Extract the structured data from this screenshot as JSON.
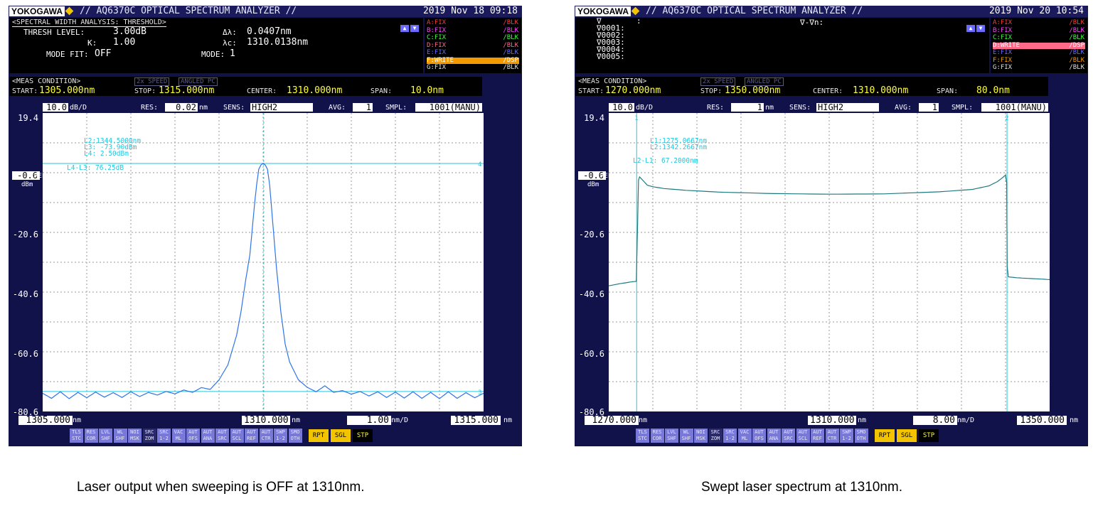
{
  "captions": {
    "left": "Laser output when sweeping is OFF at 1310nm.",
    "right": "Swept laser spectrum at 1310nm."
  },
  "colors": {
    "screen_bg": "#12124a",
    "panel_bg": "#000000",
    "value_yellow": "#ffff33",
    "trace_blue": "#2e74e8",
    "trace_teal": "#1e7a80",
    "marker_cyan": "#22c6dd",
    "orange_highlight": "#f29a00",
    "pink_highlight": "#ff6a8a"
  },
  "left": {
    "header": {
      "brand": "YOKOGAWA",
      "model": "// AQ6370C OPTICAL SPECTRUM ANALYZER //",
      "datetime": "2019 Nov 18 09:18"
    },
    "analysis": {
      "title": "<SPECTRAL WIDTH ANALYSIS: THRESHOLD>",
      "thresh_label": "THRESH LEVEL:",
      "thresh_value": "3.00dB",
      "k_label": "K:",
      "k_value": "1.00",
      "mode_fit_label": "MODE FIT:",
      "mode_fit_value": "OFF",
      "dl_label": "Δλ:",
      "dl_value": "0.0407nm",
      "lc_label": "λc:",
      "lc_value": "1310.0138nm",
      "mode_label": "MODE:",
      "mode_value": "1"
    },
    "traces": [
      {
        "label": "A:FIX",
        "mode": "/BLK",
        "color": "#ff3a3a"
      },
      {
        "label": "B:FIX",
        "mode": "/BLK",
        "color": "#ff40ff"
      },
      {
        "label": "C:FIX",
        "mode": "/BLK",
        "color": "#40ff40"
      },
      {
        "label": "D:FIX",
        "mode": "/BLK",
        "color": "#ff6a8a"
      },
      {
        "label": "E:FIX",
        "mode": "/BLK",
        "color": "#6a6aff"
      },
      {
        "label": "F:WRITE",
        "mode": "/DSP",
        "color": "#f29a00",
        "highlight": true
      },
      {
        "label": "G:FIX",
        "mode": "/BLK",
        "color": "#e0e0e0"
      }
    ],
    "meas": {
      "title": "<MEAS CONDITION>",
      "tags": [
        "2x SPEED",
        "ANGLED PC"
      ],
      "start_label": "START:",
      "start_value": "1305.000nm",
      "stop_label": "STOP:",
      "stop_value": "1315.000nm",
      "center_label": "CENTER:",
      "center_value": "1310.000nm",
      "span_label": "SPAN:",
      "span_value": "10.0nm"
    },
    "params": {
      "scale": "10.0",
      "scale_unit": "dB/D",
      "res_label": "RES:",
      "res_value": "0.02",
      "res_unit": "nm",
      "sens_label": "SENS:",
      "sens_value": "HIGH2",
      "avg_label": "AVG:",
      "avg_value": "1",
      "smpl_label": "SMPL:",
      "smpl_value": "1001(MANU)"
    },
    "ref": {
      "value": "-0.6",
      "label": "REF",
      "unit": "dBm"
    },
    "x_footer": {
      "left": "1305.000",
      "center": "1310.000",
      "per_div": "1.00",
      "right": "1315.000",
      "unit": "nm",
      "per_div_unit": "nm/D"
    },
    "marker_info": [
      "L2:1344.5000nm",
      "L3:  -73.90dBm",
      "L4:    2.50dBm",
      "L4-L3:  76.25dB"
    ],
    "marker_tags": [
      "4",
      "3"
    ]
  },
  "right": {
    "header": {
      "brand": "YOKOGAWA",
      "model": "// AQ6370C OPTICAL SPECTRUM ANALYZER //",
      "datetime": "2019 Nov 20 10:54"
    },
    "markers_panel": {
      "rows": [
        {
          "name": "∇",
          "value": ":"
        },
        {
          "name": "∇0001:",
          "value": ""
        },
        {
          "name": "∇0002:",
          "value": ""
        },
        {
          "name": "∇0003:",
          "value": ""
        },
        {
          "name": "∇0004:",
          "value": ""
        },
        {
          "name": "∇0005:",
          "value": ""
        }
      ],
      "diff_label": "∇-∇n:"
    },
    "traces": [
      {
        "label": "A:FIX",
        "mode": "/BLK",
        "color": "#ff3a3a"
      },
      {
        "label": "B:FIX",
        "mode": "/BLK",
        "color": "#ff40ff"
      },
      {
        "label": "C:FIX",
        "mode": "/BLK",
        "color": "#40ff40"
      },
      {
        "label": "D:WRITE",
        "mode": "/DSP",
        "color": "#ff6a8a",
        "highlight": true
      },
      {
        "label": "E:FIX",
        "mode": "/BLK",
        "color": "#6a6aff"
      },
      {
        "label": "F:FIX",
        "mode": "/BLK",
        "color": "#f29a00"
      },
      {
        "label": "G:FIX",
        "mode": "/BLK",
        "color": "#e0e0e0"
      }
    ],
    "meas": {
      "title": "<MEAS CONDITION>",
      "tags": [
        "2x SPEED",
        "ANGLED PC"
      ],
      "start_label": "START:",
      "start_value": "1270.000nm",
      "stop_label": "STOP:",
      "stop_value": "1350.000nm",
      "center_label": "CENTER:",
      "center_value": "1310.000nm",
      "span_label": "SPAN:",
      "span_value": "80.0nm"
    },
    "params": {
      "scale": "10.0",
      "scale_unit": "dB/D",
      "res_label": "RES:",
      "res_value": "1",
      "res_unit": "nm",
      "sens_label": "SENS:",
      "sens_value": "HIGH2",
      "avg_label": "AVG:",
      "avg_value": "1",
      "smpl_label": "SMPL:",
      "smpl_value": "1001(MANU)"
    },
    "ref": {
      "value": "-0.6",
      "label": "REF",
      "unit": "dBm"
    },
    "x_footer": {
      "left": "1270.000",
      "center": "1310.000",
      "per_div": "8.00",
      "right": "1350.000",
      "unit": "nm",
      "per_div_unit": "nm/D"
    },
    "marker_info": [
      "L1:1275.0667nm",
      "L2:1342.2667nm",
      "L2-L1:  67.2000nm"
    ],
    "marker_tags": [
      "1",
      "2"
    ]
  },
  "softkeys": [
    {
      "top": "TLS",
      "bottom": "STC"
    },
    {
      "top": "RES",
      "bottom": "COR"
    },
    {
      "top": "LVL",
      "bottom": "SHF"
    },
    {
      "top": "WL",
      "bottom": "SHF"
    },
    {
      "top": "NOI",
      "bottom": "MSK"
    },
    {
      "top": "SRC",
      "bottom": "ZOM",
      "on": true
    },
    {
      "top": "SRC",
      "bottom": "1-2"
    },
    {
      "top": "VAC",
      "bottom": "ML"
    },
    {
      "top": "AUT",
      "bottom": "OFS"
    },
    {
      "top": "AUT",
      "bottom": "ANA"
    },
    {
      "top": "AUT",
      "bottom": "SRC"
    },
    {
      "top": "AUT",
      "bottom": "SCL"
    },
    {
      "top": "AUT",
      "bottom": "REF"
    },
    {
      "top": "AUT",
      "bottom": "CTR"
    },
    {
      "top": "SWP",
      "bottom": "1-2"
    },
    {
      "top": "SMO",
      "bottom": "OTH"
    }
  ],
  "run_keys": [
    {
      "label": "RPT",
      "bg": "#f2c400",
      "fg": "#000000"
    },
    {
      "label": "SGL",
      "bg": "#f2c400",
      "fg": "#000000"
    },
    {
      "label": "STP",
      "bg": "#000000",
      "fg": "#ffff33"
    }
  ],
  "chart_data": [
    {
      "type": "line",
      "title": "",
      "xlabel": "nm",
      "ylabel": "dBm",
      "xlim": [
        1305.0,
        1315.0
      ],
      "ylim": [
        -80.6,
        19.4
      ],
      "y_ticks": [
        "19.4",
        "-0.6",
        "-20.6",
        "-40.6",
        "-60.6",
        "-80.6"
      ],
      "grid": true,
      "series": [
        {
          "color": "#2e74e8",
          "x": [
            1305.0,
            1305.2,
            1305.4,
            1305.6,
            1305.8,
            1306.0,
            1306.2,
            1306.4,
            1306.6,
            1306.8,
            1307.0,
            1307.2,
            1307.4,
            1307.6,
            1307.8,
            1308.0,
            1308.2,
            1308.4,
            1308.6,
            1308.8,
            1309.0,
            1309.2,
            1309.4,
            1309.5,
            1309.6,
            1309.7,
            1309.8,
            1309.85,
            1309.9,
            1309.95,
            1310.0,
            1310.05,
            1310.1,
            1310.15,
            1310.2,
            1310.3,
            1310.4,
            1310.5,
            1310.6,
            1310.8,
            1311.0,
            1311.2,
            1311.4,
            1311.6,
            1311.8,
            1312.0,
            1312.2,
            1312.4,
            1312.6,
            1312.8,
            1313.0,
            1313.2,
            1313.4,
            1313.6,
            1313.8,
            1314.0,
            1314.2,
            1314.4,
            1314.6,
            1314.8,
            1315.0
          ],
          "y": [
            -74.5,
            -76.2,
            -74.0,
            -76.3,
            -74.2,
            -76.0,
            -74.1,
            -75.8,
            -74.3,
            -75.9,
            -74.0,
            -75.6,
            -74.2,
            -75.1,
            -73.9,
            -74.7,
            -73.4,
            -74.2,
            -72.6,
            -73.2,
            -70.0,
            -65.0,
            -55.0,
            -47.0,
            -37.0,
            -28.0,
            -12.0,
            -5.0,
            0.5,
            2.0,
            2.5,
            2.0,
            0.5,
            -5.0,
            -14.0,
            -32.0,
            -47.0,
            -58.0,
            -64.0,
            -70.0,
            -72.5,
            -74.0,
            -72.0,
            -74.2,
            -73.6,
            -74.8,
            -73.9,
            -75.4,
            -74.0,
            -75.9,
            -74.1,
            -76.1,
            -74.0,
            -76.2,
            -74.2,
            -76.3,
            -74.0,
            -76.2,
            -74.3,
            -76.0,
            -74.5
          ]
        }
      ],
      "annotations": [
        "L2:1344.5000nm",
        "L3:  -73.90dBm",
        "L4:    2.50dBm",
        "L4-L3:  76.25dB"
      ],
      "horizontal_markers": [
        {
          "name": "L3",
          "y": -73.9
        },
        {
          "name": "L4",
          "y": 2.5
        }
      ],
      "vertical_markers": [
        {
          "name": "λc",
          "x": 1310.0138
        }
      ]
    },
    {
      "type": "line",
      "title": "",
      "xlabel": "nm",
      "ylabel": "dBm",
      "xlim": [
        1270.0,
        1350.0
      ],
      "ylim": [
        -80.6,
        19.4
      ],
      "y_ticks": [
        "19.4",
        "-0.6",
        "-20.6",
        "-40.6",
        "-60.6",
        "-80.6"
      ],
      "grid": true,
      "series": [
        {
          "color": "#1e7a80",
          "x": [
            1270.0,
            1272.0,
            1274.0,
            1275.0,
            1275.2,
            1275.4,
            1275.6,
            1276.0,
            1277.0,
            1278.0,
            1280.0,
            1284.0,
            1290.0,
            1300.0,
            1310.0,
            1320.0,
            1330.0,
            1336.0,
            1339.0,
            1340.5,
            1341.5,
            1342.0,
            1342.2,
            1342.3,
            1342.5,
            1344.0,
            1347.0,
            1350.0
          ],
          "y": [
            -38.5,
            -37.8,
            -37.2,
            -37.0,
            -21.0,
            -3.0,
            -2.0,
            -2.8,
            -4.8,
            -5.3,
            -5.9,
            -6.5,
            -7.1,
            -7.6,
            -7.8,
            -7.7,
            -7.0,
            -6.2,
            -5.0,
            -3.6,
            -2.2,
            -1.4,
            -4.0,
            -32.0,
            -35.5,
            -35.8,
            -36.1,
            -36.4
          ]
        }
      ],
      "annotations": [
        "L1:1275.0667nm",
        "L2:1342.2667nm",
        "L2-L1:  67.2000nm"
      ],
      "vertical_markers": [
        {
          "name": "L1",
          "x": 1275.0667
        },
        {
          "name": "L2",
          "x": 1342.2667
        }
      ]
    }
  ]
}
